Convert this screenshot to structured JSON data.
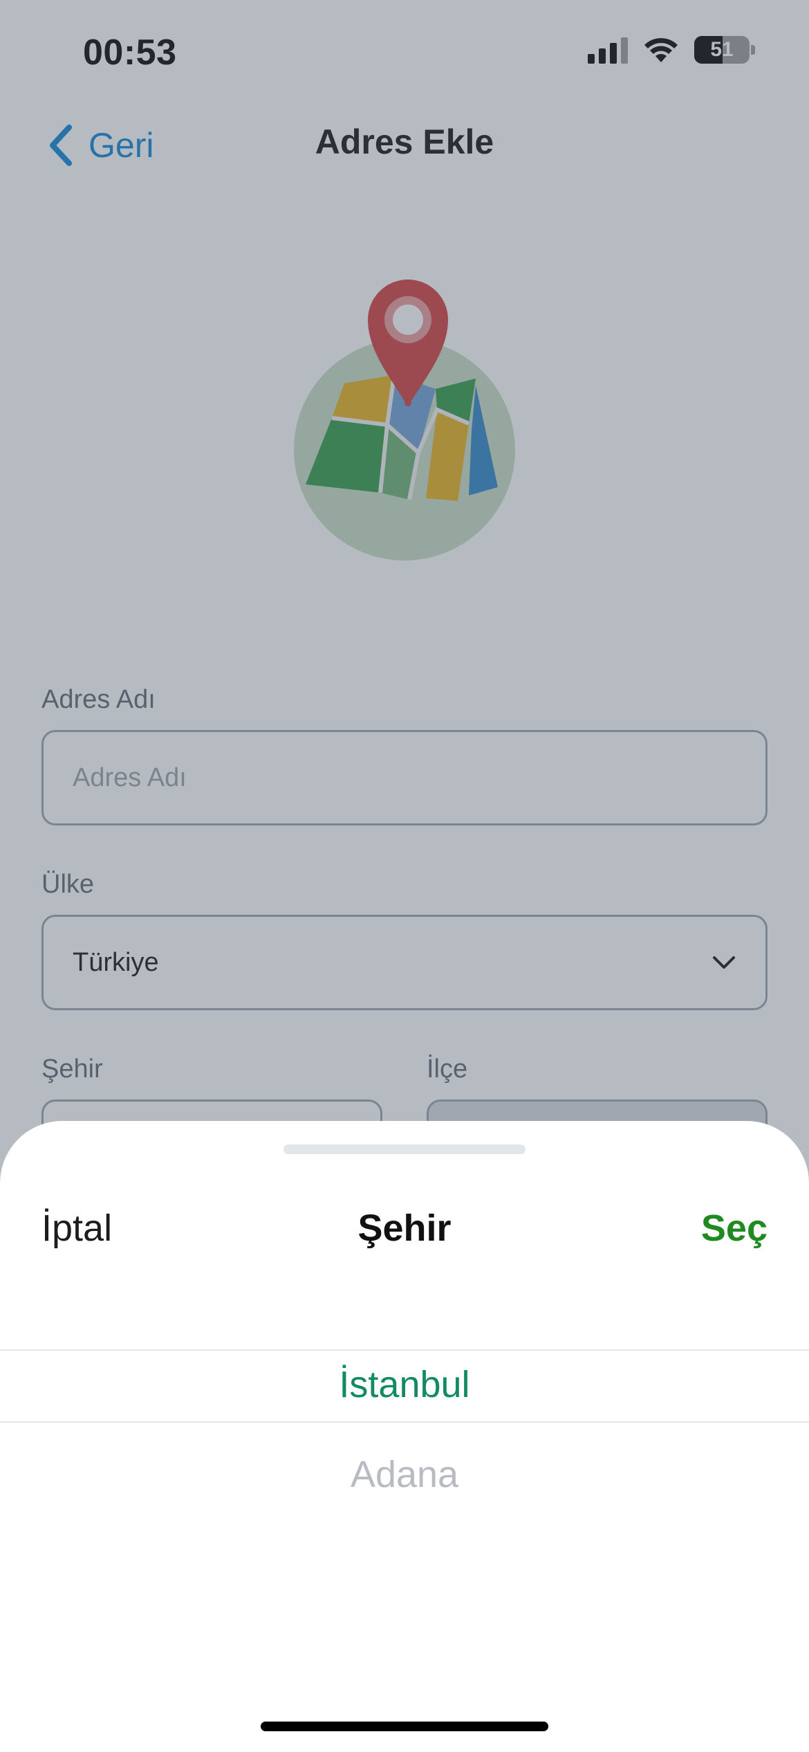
{
  "status_bar": {
    "time": "00:53",
    "battery": "51",
    "icons": [
      "signal-icon",
      "wifi-icon",
      "battery-icon"
    ]
  },
  "nav": {
    "back_label": "Geri",
    "title": "Adres Ekle"
  },
  "hero": {
    "icon": "map-pin-icon"
  },
  "form": {
    "address_name": {
      "label": "Adres Adı",
      "placeholder": "Adres Adı",
      "value": ""
    },
    "country": {
      "label": "Ülke",
      "value": "Türkiye"
    },
    "city": {
      "label": "Şehir"
    },
    "district": {
      "label": "İlçe"
    }
  },
  "sheet": {
    "cancel_label": "İptal",
    "title": "Şehir",
    "confirm_label": "Seç",
    "options": [
      "İstanbul",
      "Adana"
    ],
    "selected": "İstanbul"
  },
  "colors": {
    "accent_blue": "#0a84d6",
    "confirm_green": "#1f8a1f",
    "selected_green": "#138a60",
    "dim_overlay": "#505c6c"
  }
}
